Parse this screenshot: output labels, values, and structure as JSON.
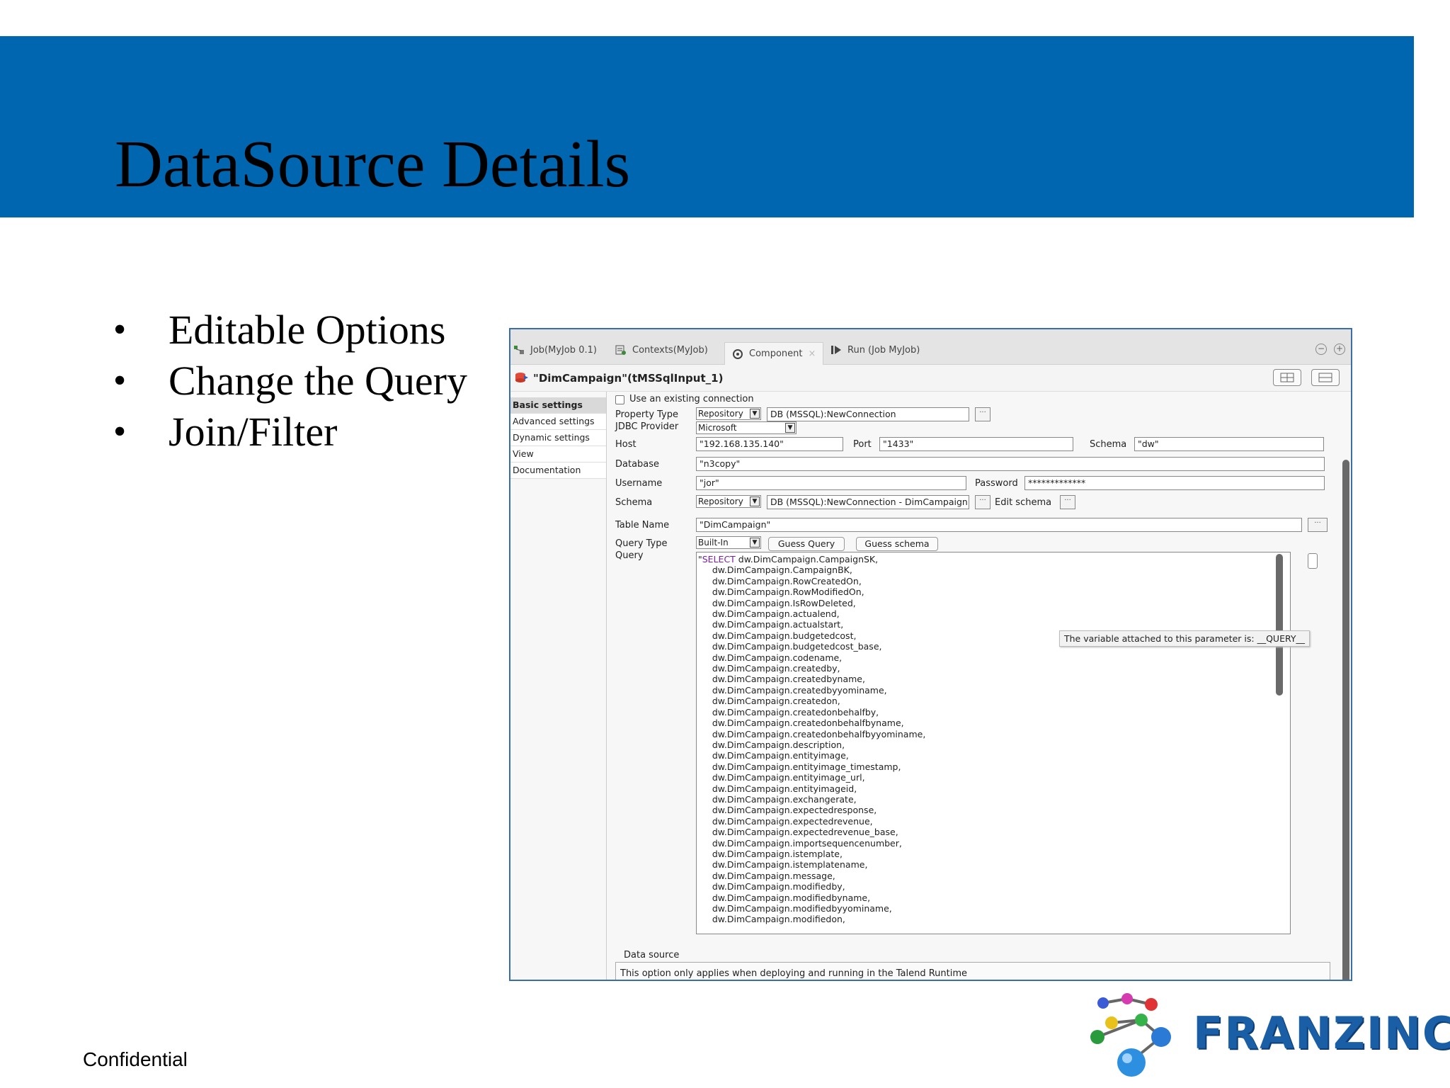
{
  "slide": {
    "title": "DataSource Details",
    "bullets": [
      "Editable Options",
      "Change the Query",
      "Join/Filter"
    ],
    "footer": "Confidential",
    "logo_text": "FRANZINC.",
    "band_color": "#0066b0"
  },
  "app": {
    "tabs": [
      {
        "label": "Job(MyJob 0.1)",
        "icon": "job-icon"
      },
      {
        "label": "Contexts(MyJob)",
        "icon": "contexts-icon"
      },
      {
        "label": "Component",
        "icon": "component-icon",
        "close": "×"
      },
      {
        "label": "Run (Job MyJob)",
        "icon": "run-icon"
      }
    ],
    "window_controls": {
      "minimize": "−",
      "maximize": "+"
    },
    "component_title": "\"DimCampaign\"(tMSSqlInput_1)",
    "sidebar": [
      "Basic settings",
      "Advanced settings",
      "Dynamic settings",
      "View",
      "Documentation"
    ],
    "form": {
      "use_existing_connection": "Use an existing connection",
      "property_type_label": "Property Type",
      "property_type_value": "Repository",
      "property_type_connection": "DB (MSSQL):NewConnection",
      "jdbc_provider_label": "JDBC Provider",
      "jdbc_provider_value": "Microsoft",
      "host_label": "Host",
      "host_value": "\"192.168.135.140\"",
      "port_label": "Port",
      "port_value": "\"1433\"",
      "schema_label": "Schema",
      "schema_value": "\"dw\"",
      "database_label": "Database",
      "database_value": "\"n3copy\"",
      "username_label": "Username",
      "username_value": "\"jor\"",
      "password_label": "Password",
      "password_value": "*************",
      "schema2_label": "Schema",
      "schema2_type": "Repository",
      "schema2_value": "DB (MSSQL):NewConnection - DimCampaign",
      "edit_schema_label": "Edit schema",
      "table_name_label": "Table Name",
      "table_name_value": "\"DimCampaign\"",
      "query_type_label": "Query Type",
      "query_type_value": "Built-In",
      "guess_query": "Guess Query",
      "guess_schema": "Guess schema",
      "query_label": "Query",
      "query_lines": [
        "\"SELECT dw.DimCampaign.CampaignSK,",
        "     dw.DimCampaign.CampaignBK,",
        "     dw.DimCampaign.RowCreatedOn,",
        "     dw.DimCampaign.RowModifiedOn,",
        "     dw.DimCampaign.IsRowDeleted,",
        "     dw.DimCampaign.actualend,",
        "     dw.DimCampaign.actualstart,",
        "     dw.DimCampaign.budgetedcost,",
        "     dw.DimCampaign.budgetedcost_base,",
        "     dw.DimCampaign.codename,",
        "     dw.DimCampaign.createdby,",
        "     dw.DimCampaign.createdbyname,",
        "     dw.DimCampaign.createdbyyominame,",
        "     dw.DimCampaign.createdon,",
        "     dw.DimCampaign.createdonbehalfby,",
        "     dw.DimCampaign.createdonbehalfbyname,",
        "     dw.DimCampaign.createdonbehalfbyyominame,",
        "     dw.DimCampaign.description,",
        "     dw.DimCampaign.entityimage,",
        "     dw.DimCampaign.entityimage_timestamp,",
        "     dw.DimCampaign.entityimage_url,",
        "     dw.DimCampaign.entityimageid,",
        "     dw.DimCampaign.exchangerate,",
        "     dw.DimCampaign.expectedresponse,",
        "     dw.DimCampaign.expectedrevenue,",
        "     dw.DimCampaign.expectedrevenue_base,",
        "     dw.DimCampaign.importsequencenumber,",
        "     dw.DimCampaign.istemplate,",
        "     dw.DimCampaign.istemplatename,",
        "     dw.DimCampaign.message,",
        "     dw.DimCampaign.modifiedby,",
        "     dw.DimCampaign.modifiedbyname,",
        "     dw.DimCampaign.modifiedbyyominame,",
        "     dw.DimCampaign.modifiedon,"
      ],
      "tooltip": "The variable attached to this parameter is: __QUERY__",
      "data_source_label": "Data source",
      "data_source_note": "This option only applies when deploying and running in the Talend Runtime"
    }
  }
}
